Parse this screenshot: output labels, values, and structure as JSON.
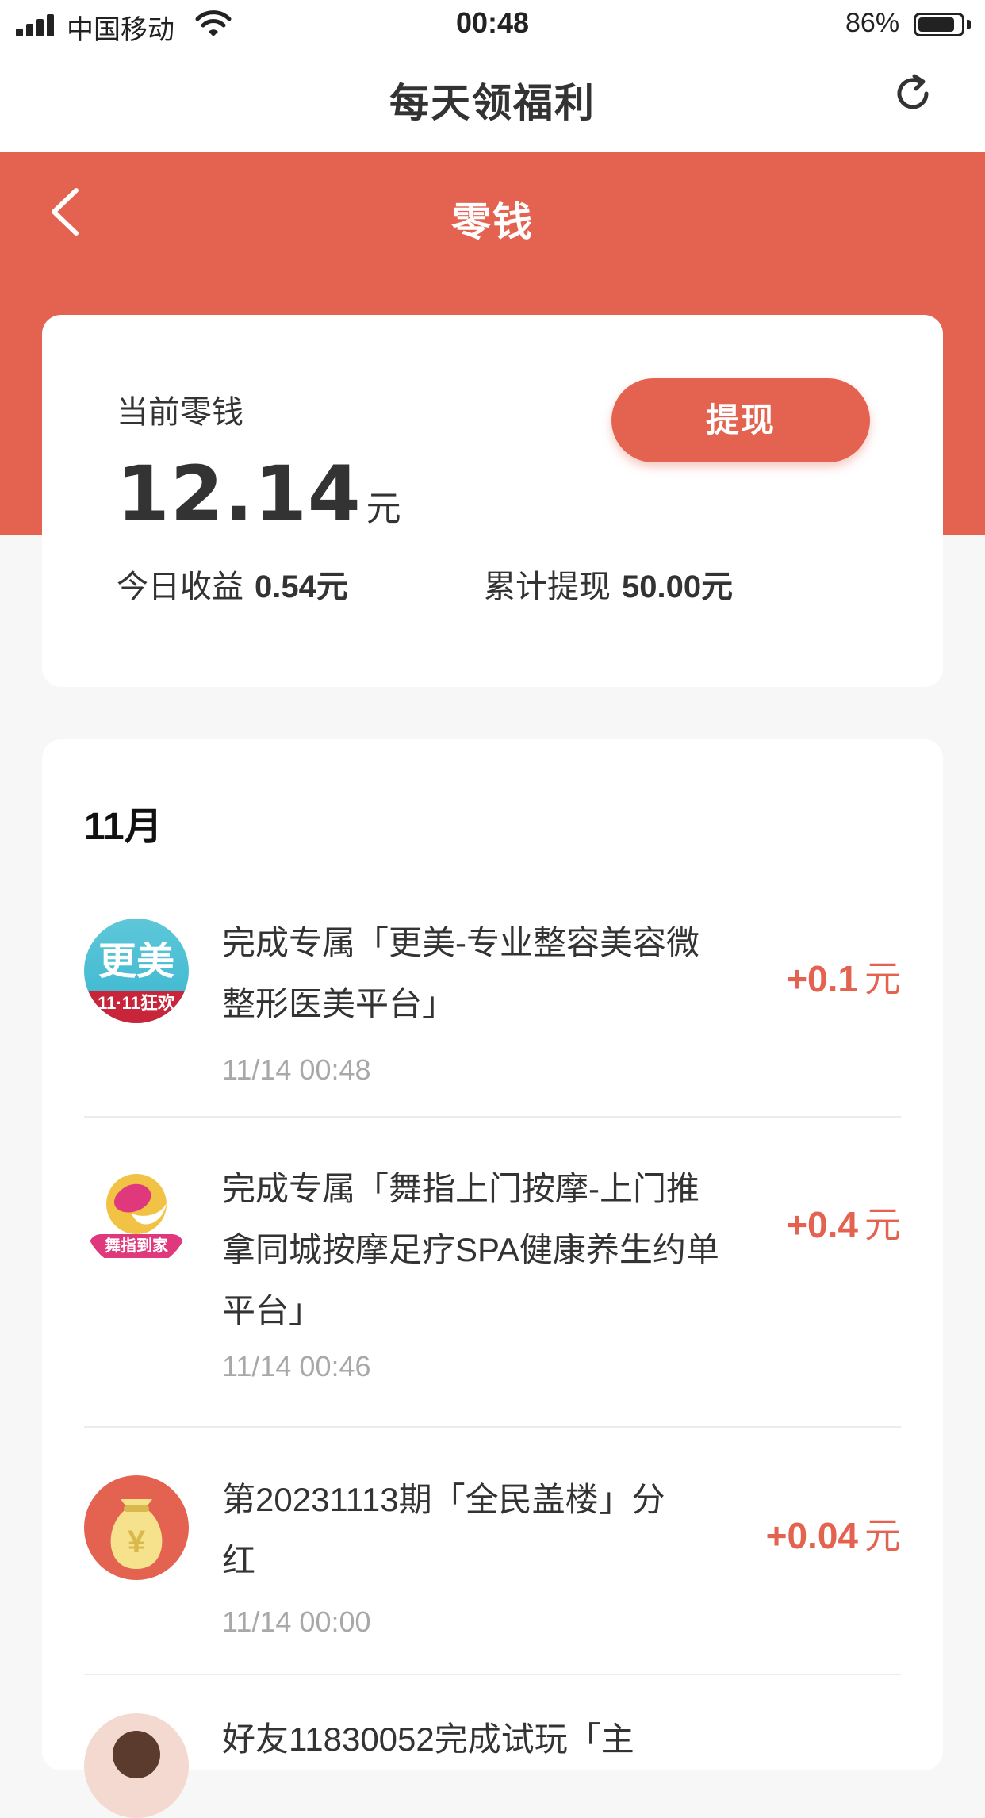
{
  "status_bar": {
    "carrier": "中国移动",
    "time": "00:48",
    "battery": "86%",
    "battery_level": 0.86
  },
  "top_nav": {
    "title": "每天领福利"
  },
  "header": {
    "title": "零钱"
  },
  "balance": {
    "label": "当前零钱",
    "amount": "12.14",
    "unit": "元",
    "withdraw_button": "提现",
    "today_label": "今日收益",
    "today_value": "0.54元",
    "total_label": "累计提现",
    "total_value": "50.00元"
  },
  "records": {
    "month": "11月",
    "items": [
      {
        "desc": "完成专属「更美-专业整容美容微整形医美平台」",
        "time": "11/14 00:48",
        "amount": "+0.1",
        "unit": "元",
        "icon": "gengmei-app-icon",
        "icon_text": "更美",
        "icon_sub": "11·11狂欢"
      },
      {
        "desc": "完成专属「舞指上门按摩-上门推拿同城按摩足疗SPA健康养生约单平台」",
        "time": "11/14 00:46",
        "amount": "+0.4",
        "unit": "元",
        "icon": "wuzhi-app-icon",
        "icon_sub": "舞指到家"
      },
      {
        "desc": "第20231113期「全民盖楼」分红",
        "time": "11/14 00:00",
        "amount": "+0.04",
        "unit": "元",
        "icon": "money-bag-icon",
        "icon_symbol": "¥"
      },
      {
        "desc": "好友11830052完成试玩「主",
        "time": "",
        "amount": "",
        "unit": "",
        "icon": "friend-avatar-icon"
      }
    ]
  },
  "colors": {
    "accent": "#e46350",
    "background": "#f7f7f7",
    "muted": "#a8a8a8"
  }
}
